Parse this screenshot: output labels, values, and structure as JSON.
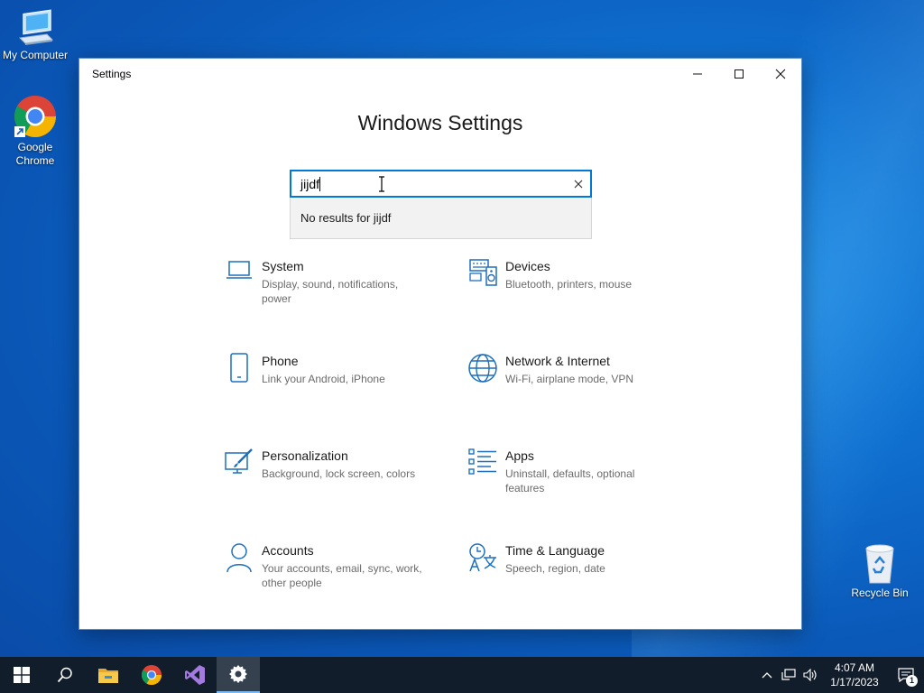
{
  "desktop": {
    "icons": [
      {
        "label": "My Computer",
        "icon": "computer-icon"
      },
      {
        "label": "Google\nChrome",
        "icon": "chrome-icon"
      },
      {
        "label": "Recycle Bin",
        "icon": "recycle-bin-icon"
      }
    ]
  },
  "window": {
    "title": "Settings",
    "heading": "Windows Settings",
    "search": {
      "value": "jijdf",
      "no_results": "No results for jijdf"
    },
    "tiles": [
      {
        "title": "System",
        "desc": "Display, sound, notifications, power",
        "icon": "laptop-icon"
      },
      {
        "title": "Devices",
        "desc": "Bluetooth, printers, mouse",
        "icon": "keyboard-speaker-icon"
      },
      {
        "title": "Phone",
        "desc": "Link your Android, iPhone",
        "icon": "phone-icon"
      },
      {
        "title": "Network & Internet",
        "desc": "Wi-Fi, airplane mode, VPN",
        "icon": "globe-icon"
      },
      {
        "title": "Personalization",
        "desc": "Background, lock screen, colors",
        "icon": "paintbrush-icon"
      },
      {
        "title": "Apps",
        "desc": "Uninstall, defaults, optional features",
        "icon": "apps-list-icon"
      },
      {
        "title": "Accounts",
        "desc": "Your accounts, email, sync, work, other people",
        "icon": "person-icon"
      },
      {
        "title": "Time & Language",
        "desc": "Speech, region, date",
        "icon": "time-language-icon"
      }
    ]
  },
  "taskbar": {
    "apps": [
      "start-icon",
      "search-icon",
      "file-explorer-icon",
      "chrome-icon",
      "visual-studio-icon",
      "settings-gear-icon"
    ],
    "clock_time": "4:07 AM",
    "clock_date": "1/17/2023",
    "notification_count": "1"
  },
  "colors": {
    "accent": "#0078d7",
    "taskbar": "#121d2b"
  }
}
